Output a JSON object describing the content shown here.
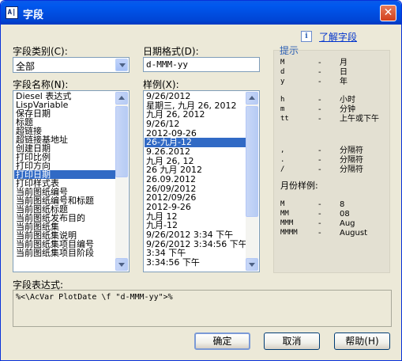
{
  "window": {
    "title": "字段",
    "icon": "field-app-icon",
    "close_glyph": "✕"
  },
  "category": {
    "label": "字段类别(C):",
    "value": "全部"
  },
  "date_format": {
    "label": "日期格式(D):",
    "value": "d-MMM-yy"
  },
  "field_names": {
    "label": "字段名称(N):",
    "items": [
      "Diesel 表达式",
      "LispVariable",
      "保存日期",
      "标题",
      "超链接",
      "超链接基地址",
      "创建日期",
      "打印比例",
      "打印方向",
      "打印日期",
      "打印样式表",
      "当前图纸编号",
      "当前图纸编号和标题",
      "当前图纸标题",
      "当前图纸发布目的",
      "当前图纸集",
      "当前图纸集说明",
      "当前图纸集项目编号",
      "当前图纸集项目阶段"
    ],
    "selected_index": 9
  },
  "examples": {
    "label": "样例(X):",
    "items": [
      "9/26/2012",
      "星期三, 九月 26, 2012",
      "九月 26, 2012",
      "9/26/12",
      "2012-09-26",
      "26-九月-12",
      "9.26.2012",
      "九月 26, 12",
      "26 九月 2012",
      "26.09.2012",
      "26/09/2012",
      "2012/09/26",
      "2012-9-26",
      "九月 12",
      "九月-12",
      "9/26/2012 3:34 下午",
      "9/26/2012 3:34:56 下午",
      "3:34 下午",
      "3:34:56 下午"
    ],
    "selected_index": 5
  },
  "help": {
    "icon": "info-icon",
    "link": "了解字段"
  },
  "hints": {
    "title": "提示",
    "rows": [
      {
        "code": "M",
        "desc": "月"
      },
      {
        "code": "d",
        "desc": "日"
      },
      {
        "code": "y",
        "desc": "年"
      },
      {
        "code": "h",
        "desc": "小时"
      },
      {
        "code": "m",
        "desc": "分钟"
      },
      {
        "code": "tt",
        "desc": "上午或下午"
      },
      {
        "code": ",",
        "desc": "分隔符"
      },
      {
        "code": ".",
        "desc": "分隔符"
      },
      {
        "code": "/",
        "desc": "分隔符"
      }
    ],
    "month_title": "月份样例:",
    "month_rows": [
      {
        "code": "M",
        "desc": "8"
      },
      {
        "code": "MM",
        "desc": "08"
      },
      {
        "code": "MMM",
        "desc": "Aug"
      },
      {
        "code": "MMMM",
        "desc": "August"
      }
    ]
  },
  "expression": {
    "label": "字段表达式:",
    "value": "%<\\AcVar PlotDate \\f \"d-MMM-yy\">%"
  },
  "buttons": {
    "ok": "确定",
    "cancel": "取消",
    "help": "帮助(H)"
  }
}
